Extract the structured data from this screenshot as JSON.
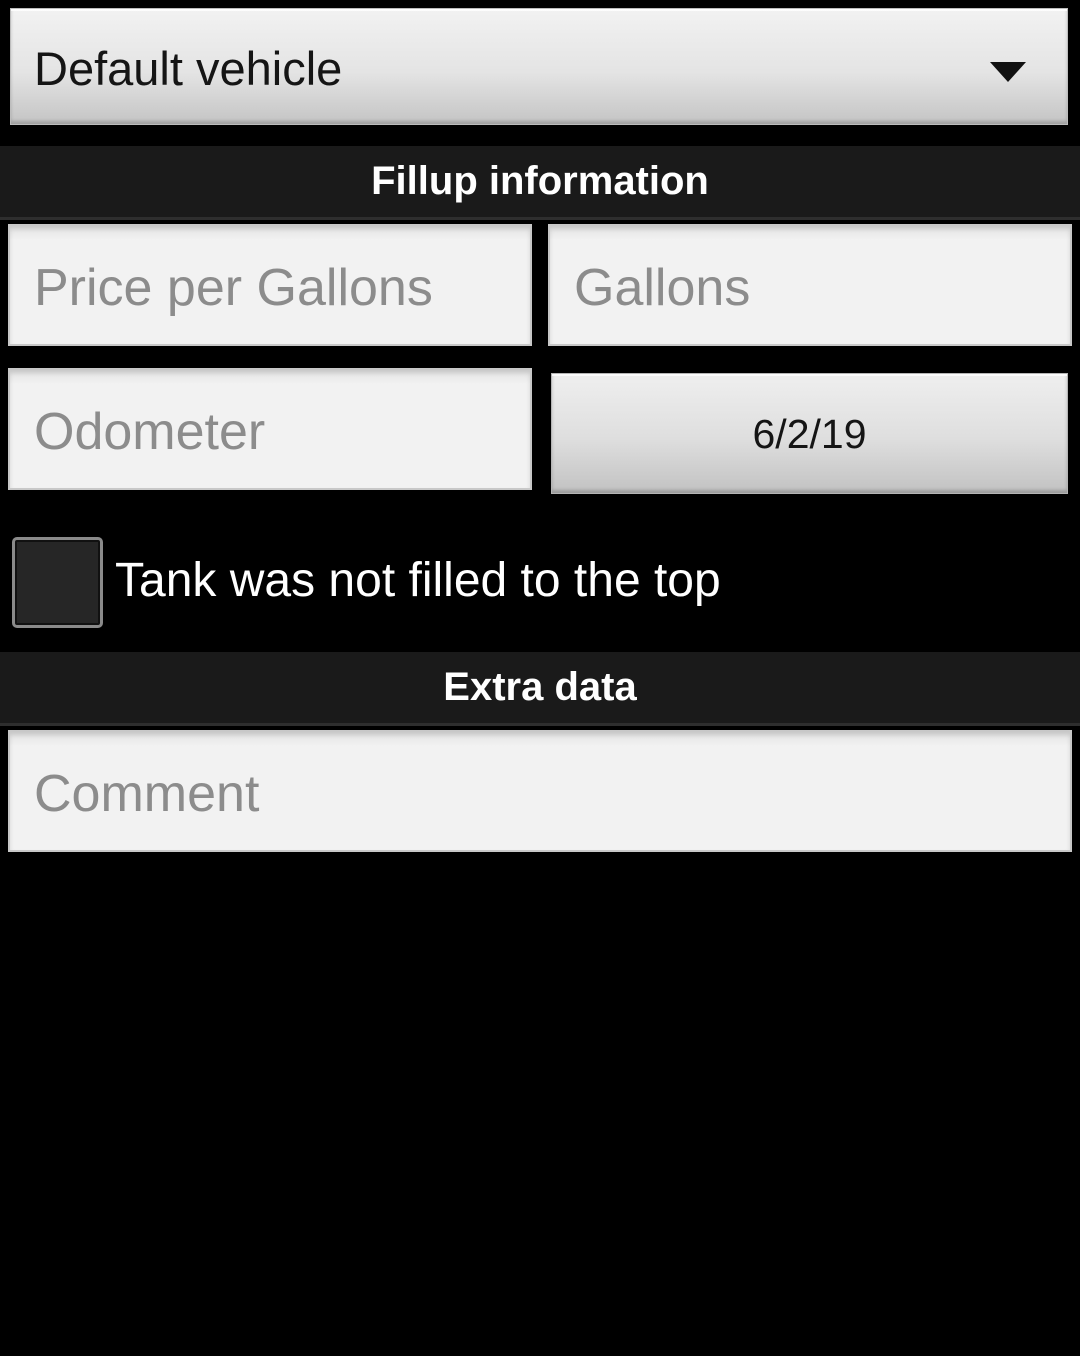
{
  "vehicle_spinner": {
    "selected": "Default vehicle",
    "arrow_icon": "triangle-down-icon"
  },
  "sections": {
    "fillup_title": "Fillup information",
    "extra_title": "Extra data"
  },
  "fillup": {
    "price_per_gallon": {
      "value": "",
      "placeholder": "Price per Gallons"
    },
    "gallons": {
      "value": "",
      "placeholder": "Gallons"
    },
    "odometer": {
      "value": "",
      "placeholder": "Odometer"
    },
    "date_label": "6/2/19",
    "partial_fill": {
      "label": "Tank was not filled to the top",
      "checked": false
    }
  },
  "extra": {
    "comment": {
      "value": "",
      "placeholder": "Comment"
    }
  },
  "colors": {
    "background": "#000000",
    "header_background": "#1a1a1a",
    "field_background": "#f2f2f2",
    "placeholder_text": "#8c8c8c"
  }
}
